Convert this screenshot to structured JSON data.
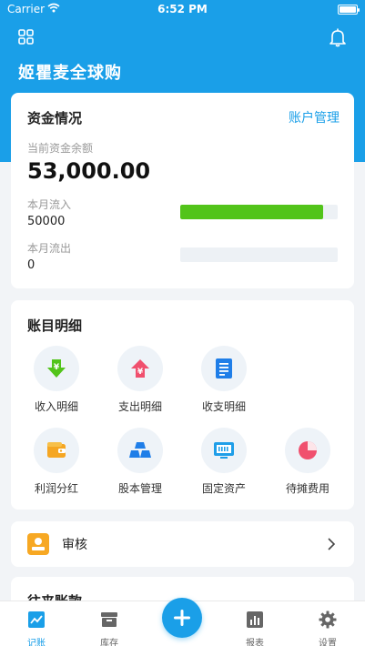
{
  "status_bar": {
    "carrier": "Carrier",
    "time": "6:52 PM"
  },
  "header": {
    "app_title": "姬瞿麦全球购"
  },
  "funds": {
    "title": "资金情况",
    "manage_link": "账户管理",
    "balance_label": "当前资金余额",
    "balance_value": "53,000.00",
    "inflow_label": "本月流入",
    "inflow_value": "50000",
    "inflow_bar_fraction": 0.91,
    "outflow_label": "本月流出",
    "outflow_value": "0",
    "outflow_bar_fraction": 0
  },
  "ledger": {
    "title": "账目明细",
    "items": [
      {
        "label": "收入明细",
        "icon": "income-down-arrow-icon"
      },
      {
        "label": "支出明细",
        "icon": "expense-up-arrow-icon"
      },
      {
        "label": "收支明细",
        "icon": "document-list-icon"
      },
      {
        "label": "利润分红",
        "icon": "wallet-icon"
      },
      {
        "label": "股本管理",
        "icon": "stacked-gold-icon"
      },
      {
        "label": "固定资产",
        "icon": "monitor-icon"
      },
      {
        "label": "待摊费用",
        "icon": "pie-chart-icon"
      }
    ]
  },
  "audit": {
    "label": "审核"
  },
  "partial": {
    "title": "往来账款"
  },
  "tabs": [
    {
      "label": "记账",
      "icon": "chart-line-icon",
      "active": true
    },
    {
      "label": "库存",
      "icon": "archive-box-icon",
      "active": false
    },
    {
      "label": "报表",
      "icon": "bar-report-icon",
      "active": false
    },
    {
      "label": "设置",
      "icon": "gear-icon",
      "active": false
    }
  ],
  "colors": {
    "primary": "#1a9fe8",
    "income_bar": "#52c41a",
    "audit_icon": "#f7a823"
  }
}
